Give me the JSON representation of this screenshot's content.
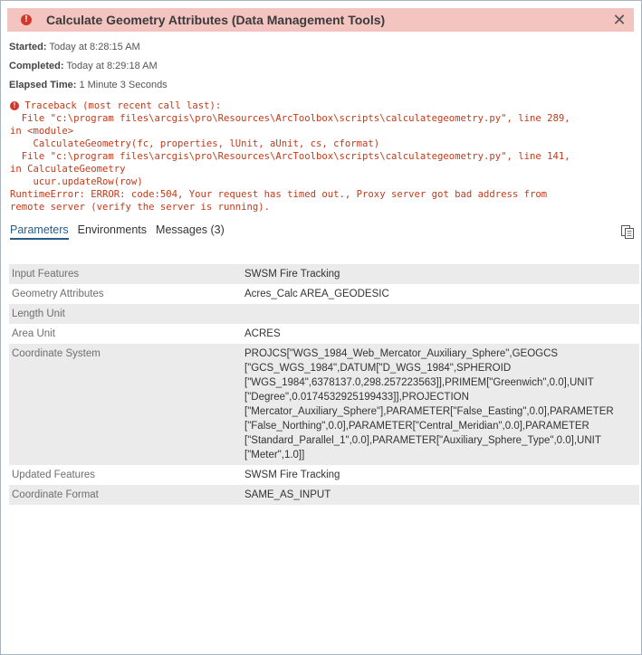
{
  "header": {
    "title": "Calculate Geometry Attributes (Data Management Tools)"
  },
  "meta": {
    "started_label": "Started:",
    "started": "Today at 8:28:15 AM",
    "completed_label": "Completed:",
    "completed": "Today at 8:29:18 AM",
    "elapsed_label": "Elapsed Time:",
    "elapsed": "1 Minute 3 Seconds"
  },
  "traceback": {
    "lines": [
      "Traceback (most recent call last):",
      "  File \"c:\\program files\\arcgis\\pro\\Resources\\ArcToolbox\\scripts\\calculategeometry.py\", line 289,",
      "in <module>",
      "    CalculateGeometry(fc, properties, lUnit, aUnit, cs, cformat)",
      "  File \"c:\\program files\\arcgis\\pro\\Resources\\ArcToolbox\\scripts\\calculategeometry.py\", line 141,",
      "in CalculateGeometry",
      "    ucur.updateRow(row)",
      "RuntimeError: ERROR: code:504, Your request has timed out., Proxy server got bad address from",
      "remote server (verify the server is running)."
    ]
  },
  "tabs": [
    {
      "label": "Parameters"
    },
    {
      "label": "Environments"
    },
    {
      "label": "Messages (3)"
    }
  ],
  "params": [
    {
      "key": "Input Features",
      "value": "SWSM Fire Tracking"
    },
    {
      "key": "Geometry Attributes",
      "value": "Acres_Calc AREA_GEODESIC"
    },
    {
      "key": "Length Unit",
      "value": ""
    },
    {
      "key": "Area Unit",
      "value": "ACRES"
    },
    {
      "key": "Coordinate System",
      "value_lines": [
        "PROJCS[\"WGS_1984_Web_Mercator_Auxiliary_Sphere\",GEOGCS",
        "[\"GCS_WGS_1984\",DATUM[\"D_WGS_1984\",SPHEROID",
        "[\"WGS_1984\",6378137.0,298.257223563]],PRIMEM[\"Greenwich\",0.0],UNIT",
        "[\"Degree\",0.0174532925199433]],PROJECTION",
        "[\"Mercator_Auxiliary_Sphere\"],PARAMETER[\"False_Easting\",0.0],PARAMETER",
        "[\"False_Northing\",0.0],PARAMETER[\"Central_Meridian\",0.0],PARAMETER",
        "[\"Standard_Parallel_1\",0.0],PARAMETER[\"Auxiliary_Sphere_Type\",0.0],UNIT",
        "[\"Meter\",1.0]]"
      ]
    },
    {
      "key": "Updated Features",
      "value": "SWSM Fire Tracking"
    },
    {
      "key": "Coordinate Format",
      "value": "SAME_AS_INPUT"
    }
  ],
  "colors": {
    "header_bg": "#f4c4c0",
    "error_red": "#c23a1a",
    "tab_active": "#2a5b84"
  },
  "icons": {
    "header": "error-circle-icon",
    "close": "close-icon",
    "copy": "copy-icon"
  }
}
